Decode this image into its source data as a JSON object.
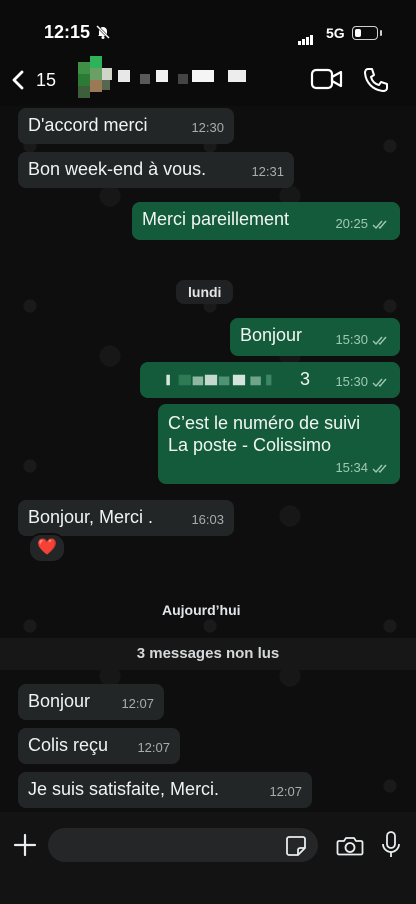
{
  "status": {
    "time": "12:15",
    "network": "5G"
  },
  "header": {
    "back_count": "15"
  },
  "chat": {
    "messages": [
      {
        "text": "D'accord merci",
        "time": "12:30"
      },
      {
        "text": "Bon week-end à vous.",
        "time": "12:31"
      },
      {
        "text": "Merci pareillement",
        "time": "20:25"
      },
      {
        "day": "lundi"
      },
      {
        "text": "Bonjour",
        "time": "15:30"
      },
      {
        "text": "3",
        "time": "15:30"
      },
      {
        "text": "C’est le numéro de suivi\nLa poste - Colissimo",
        "time": "15:34"
      },
      {
        "text": "Bonjour, Merci .",
        "time": "16:03",
        "reaction": "❤️"
      },
      {
        "day": "Aujourd’hui"
      },
      {
        "unread": "3 messages non lus"
      },
      {
        "text": "Bonjour",
        "time": "12:07"
      },
      {
        "text": "Colis reçu",
        "time": "12:07"
      },
      {
        "text": "Je suis satisfaite, Merci.",
        "time": "12:07"
      }
    ]
  },
  "colors": {
    "outgoing": "#145b3b",
    "incoming": "#232627",
    "background": "#0e0e0e"
  },
  "icons": {
    "back": "chevron-left-icon",
    "video": "video-call-icon",
    "call": "phone-icon",
    "plus": "plus-icon",
    "sticker": "sticker-icon",
    "camera": "camera-icon",
    "mic": "microphone-icon"
  }
}
